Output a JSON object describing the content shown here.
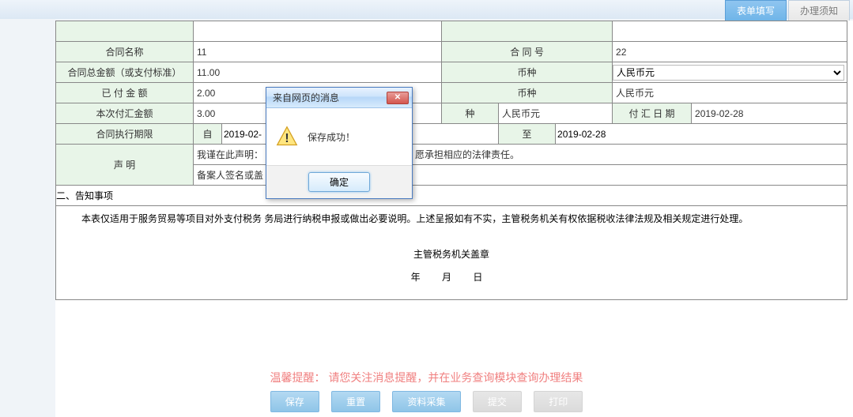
{
  "header": {
    "tab_active": "表单填写",
    "tab_inactive": "办理须知"
  },
  "form": {
    "row_name": {
      "lbl1": "合同名称",
      "val1": "11",
      "lbl2": "合 同 号",
      "val2": "22"
    },
    "row_total": {
      "lbl1": "合同总金额（或支付标准）",
      "val1": "11.00",
      "lbl2": "币种",
      "val2": "人民币元"
    },
    "row_paid": {
      "lbl1": "已 付 金 额",
      "val1": "2.00",
      "lbl2": "币种",
      "val2": "人民币元"
    },
    "row_this": {
      "lbl1": "本次付汇金额",
      "val1": "3.00",
      "lbl3": "种",
      "val3": "人民币元",
      "lbl4": "付 汇 日 期",
      "val4": "2019-02-28"
    },
    "row_period": {
      "lbl1": "合同执行期限",
      "lbl_from": "自",
      "val_from": "2019-02-",
      "lbl_to": "至",
      "val_to": "2019-02-28"
    },
    "statement": {
      "lbl": "声    明",
      "line1_a": "我谨在此声明：",
      "line1_b": "；愿承担相应的法律责任。",
      "line2": "备案人签名或盖"
    },
    "section2": "二、告知事项",
    "notice": "本表仅适用于服务贸易等项目对外支付税务                           务局进行纳税申报或做出必要说明。上述呈报如有不实，主管税务机关有权依据税收法律法规及相关规定进行处理。",
    "stamp": "主管税务机关盖章",
    "date_fmt": "年  月  日"
  },
  "footer": {
    "tip_label": "温馨提醒：",
    "tip_text": "请您关注消息提醒，并在业务查询模块查询办理结果",
    "btn_save": "保存",
    "btn_reset": "重置",
    "btn_collect": "资料采集",
    "btn_submit": "提交",
    "btn_print": "打印"
  },
  "dialog": {
    "title": "来自网页的消息",
    "close_glyph": "✕",
    "message": "保存成功！",
    "ok": "确定"
  }
}
